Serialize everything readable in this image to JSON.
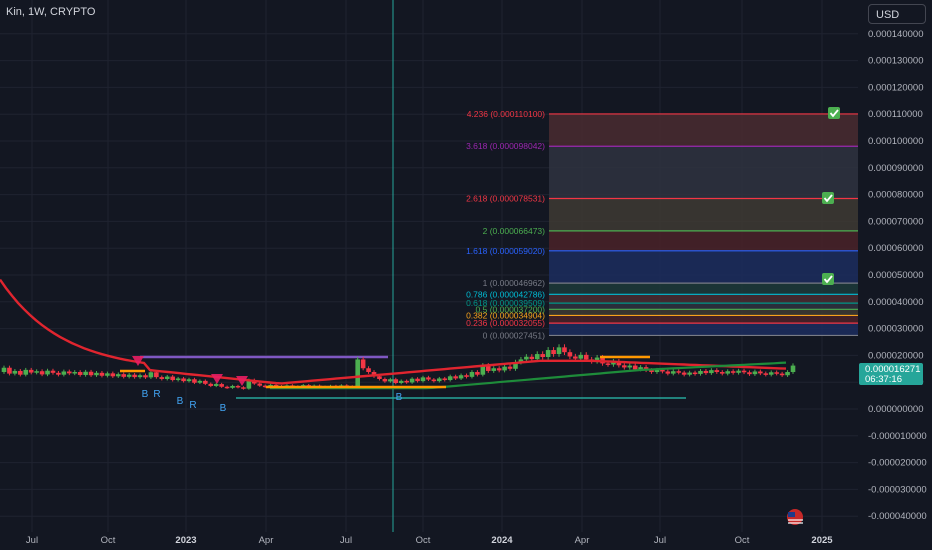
{
  "header": {
    "symbol": "Kin, 1W, CRYPTO",
    "currency": "USD"
  },
  "price_tag": {
    "price": "0.000016271",
    "timer": "06:37:16",
    "color": "#26a69a"
  },
  "colors": {
    "up": "#4caf50",
    "down": "#f23645",
    "background": "#131722",
    "grid": "#1f2330",
    "ma_red": "#e0252f",
    "ma_green": "#1e8c3a"
  },
  "chart_data": {
    "type": "candlestick",
    "y_axis": {
      "labels": [
        "0.000140000",
        "0.000130000",
        "0.000120000",
        "0.000110000",
        "0.000100000",
        "0.000090000",
        "0.000080000",
        "0.000070000",
        "0.000060000",
        "0.000050000",
        "0.000040000",
        "0.000030000",
        "0.000020000",
        "0.000010000",
        "0.000000000",
        "-0.000010000",
        "-0.000020000",
        "-0.000030000",
        "-0.000040000"
      ],
      "range": [
        -4.2e-05,
        0.000148
      ]
    },
    "x_axis": {
      "labels": [
        {
          "text": "Jul",
          "year": false
        },
        {
          "text": "Oct",
          "year": false
        },
        {
          "text": "2023",
          "year": true
        },
        {
          "text": "Apr",
          "year": false
        },
        {
          "text": "Jul",
          "year": false
        },
        {
          "text": "Oct",
          "year": false
        },
        {
          "text": "2024",
          "year": true
        },
        {
          "text": "Apr",
          "year": false
        },
        {
          "text": "Jul",
          "year": false
        },
        {
          "text": "Oct",
          "year": false
        },
        {
          "text": "2025",
          "year": true
        }
      ]
    },
    "fibonacci": [
      {
        "label": "4.236 (0.000110100)",
        "value": 0.0001101,
        "color": "#f23645"
      },
      {
        "label": "3.618 (0.000098042)",
        "value": 9.8042e-05,
        "color": "#9c27b0"
      },
      {
        "label": "2.618 (0.000078531)",
        "value": 7.8531e-05,
        "color": "#f23645"
      },
      {
        "label": "2 (0.000066473)",
        "value": 6.6473e-05,
        "color": "#4caf50"
      },
      {
        "label": "1.618 (0.000059020)",
        "value": 5.902e-05,
        "color": "#2962ff"
      },
      {
        "label": "1 (0.000046962)",
        "value": 4.6962e-05,
        "color": "#787b86"
      },
      {
        "label": "0.786 (0.000042786)",
        "value": 4.2786e-05,
        "color": "#00bcd4"
      },
      {
        "label": "0.618 (0.000039509)",
        "value": 3.9509e-05,
        "color": "#009688"
      },
      {
        "label": "0.5 (0.000037200)",
        "value": 3.72e-05,
        "color": "#4caf50"
      },
      {
        "label": "0.382 (0.000034904)",
        "value": 3.4904e-05,
        "color": "#f7a21b"
      },
      {
        "label": "0.236 (0.000032055)",
        "value": 3.2055e-05,
        "color": "#f23645"
      },
      {
        "label": "0 (0.000027451)",
        "value": 2.7451e-05,
        "color": "#787b86"
      }
    ],
    "fib_zones": [
      "#4a2c30",
      "#2f3340",
      "#3e3a33",
      "#4a2228",
      "#1c2d5e",
      "#1c3a3a"
    ],
    "markers": [
      "B",
      "R",
      "B",
      "R",
      "B",
      "B"
    ],
    "candles": [
      [
        1.38e-05,
        1.54e-05
      ],
      [
        1.54e-05,
        1.32e-05
      ],
      [
        1.32e-05,
        1.42e-05
      ],
      [
        1.42e-05,
        1.28e-05
      ],
      [
        1.28e-05,
        1.46e-05
      ],
      [
        1.46e-05,
        1.36e-05
      ],
      [
        1.36e-05,
        1.41e-05
      ],
      [
        1.41e-05,
        1.29e-05
      ],
      [
        1.29e-05,
        1.43e-05
      ],
      [
        1.43e-05,
        1.35e-05
      ],
      [
        1.35e-05,
        1.28e-05
      ],
      [
        1.28e-05,
        1.4e-05
      ],
      [
        1.4e-05,
        1.33e-05
      ],
      [
        1.33e-05,
        1.38e-05
      ],
      [
        1.38e-05,
        1.27e-05
      ],
      [
        1.27e-05,
        1.39e-05
      ],
      [
        1.39e-05,
        1.26e-05
      ],
      [
        1.26e-05,
        1.35e-05
      ],
      [
        1.35e-05,
        1.24e-05
      ],
      [
        1.24e-05,
        1.33e-05
      ],
      [
        1.33e-05,
        1.22e-05
      ],
      [
        1.22e-05,
        1.3e-05
      ],
      [
        1.3e-05,
        1.2e-05
      ],
      [
        1.2e-05,
        1.28e-05
      ],
      [
        1.28e-05,
        1.19e-05
      ],
      [
        1.19e-05,
        1.26e-05
      ],
      [
        1.26e-05,
        1.18e-05
      ],
      [
        1.18e-05,
        1.37e-05
      ],
      [
        1.37e-05,
        1.19e-05
      ],
      [
        1.19e-05,
        1.12e-05
      ],
      [
        1.12e-05,
        1.21e-05
      ],
      [
        1.21e-05,
        1.08e-05
      ],
      [
        1.08e-05,
        1.14e-05
      ],
      [
        1.14e-05,
        1.04e-05
      ],
      [
        1.04e-05,
        1.11e-05
      ],
      [
        1.11e-05,
        9.8e-06
      ],
      [
        9.8e-06,
        1.05e-05
      ],
      [
        1.05e-05,
        9.4e-06
      ],
      [
        9.4e-06,
        8.6e-06
      ],
      [
        8.6e-06,
        9.3e-06
      ],
      [
        9.3e-06,
        8.3e-06
      ],
      [
        8.3e-06,
        7.9e-06
      ],
      [
        7.9e-06,
        8.6e-06
      ],
      [
        8.6e-06,
        8.1e-06
      ],
      [
        8.1e-06,
        7.6e-06
      ],
      [
        7.6e-06,
        1.08e-05
      ],
      [
        1.08e-05,
        9.5e-06
      ],
      [
        9.5e-06,
        8.7e-06
      ],
      [
        8.7e-06,
        8.3e-06
      ],
      [
        8.3e-06,
        9e-06
      ],
      [
        9e-06,
        8.5e-06
      ],
      [
        8.5e-06,
        8.1e-06
      ],
      [
        8.1e-06,
        8.8e-06
      ],
      [
        8.8e-06,
        8.4e-06
      ],
      [
        8.4e-06,
        8e-06
      ],
      [
        8e-06,
        8.9e-06
      ],
      [
        8.9e-06,
        8.2e-06
      ],
      [
        8.2e-06,
        8.7e-06
      ],
      [
        8.7e-06,
        8.3e-06
      ],
      [
        8.3e-06,
        7.9e-06
      ],
      [
        7.9e-06,
        8.6e-06
      ],
      [
        8.6e-06,
        8.2e-06
      ],
      [
        8.2e-06,
        8.8e-06
      ],
      [
        8.8e-06,
        8.4e-06
      ],
      [
        8.4e-06,
        8e-06
      ],
      [
        8e-06,
        1.85e-05
      ],
      [
        1.85e-05,
        1.52e-05
      ],
      [
        1.52e-05,
        1.38e-05
      ],
      [
        1.38e-05,
        1.22e-05
      ],
      [
        1.22e-05,
        1.12e-05
      ],
      [
        1.12e-05,
        1.03e-05
      ],
      [
        1.03e-05,
        1.11e-05
      ],
      [
        1.11e-05,
        9.7e-06
      ],
      [
        9.7e-06,
        1.05e-05
      ],
      [
        1.05e-05,
        9.9e-06
      ],
      [
        9.9e-06,
        1.13e-05
      ],
      [
        1.13e-05,
        1.04e-05
      ],
      [
        1.04e-05,
        1.18e-05
      ],
      [
        1.18e-05,
        1.1e-05
      ],
      [
        1.1e-05,
        1.04e-05
      ],
      [
        1.04e-05,
        1.14e-05
      ],
      [
        1.14e-05,
        1.08e-05
      ],
      [
        1.08e-05,
        1.22e-05
      ],
      [
        1.22e-05,
        1.14e-05
      ],
      [
        1.14e-05,
        1.26e-05
      ],
      [
        1.26e-05,
        1.2e-05
      ],
      [
        1.2e-05,
        1.38e-05
      ],
      [
        1.38e-05,
        1.28e-05
      ],
      [
        1.28e-05,
        1.63e-05
      ],
      [
        1.63e-05,
        1.42e-05
      ],
      [
        1.42e-05,
        1.52e-05
      ],
      [
        1.52e-05,
        1.44e-05
      ],
      [
        1.44e-05,
        1.58e-05
      ],
      [
        1.58e-05,
        1.5e-05
      ],
      [
        1.5e-05,
        1.75e-05
      ],
      [
        1.75e-05,
        1.85e-05
      ],
      [
        1.85e-05,
        1.95e-05
      ],
      [
        1.95e-05,
        1.86e-05
      ],
      [
        1.86e-05,
        2.05e-05
      ],
      [
        2.05e-05,
        1.94e-05
      ],
      [
        1.94e-05,
        2.2e-05
      ],
      [
        2.2e-05,
        2.05e-05
      ],
      [
        2.05e-05,
        2.3e-05
      ],
      [
        2.3e-05,
        2.12e-05
      ],
      [
        2.12e-05,
        1.96e-05
      ],
      [
        1.96e-05,
        1.88e-05
      ],
      [
        1.88e-05,
        2.02e-05
      ],
      [
        2.02e-05,
        1.85e-05
      ],
      [
        1.85e-05,
        1.78e-05
      ],
      [
        1.78e-05,
        1.92e-05
      ],
      [
        1.92e-05,
        1.7e-05
      ],
      [
        1.7e-05,
        1.66e-05
      ],
      [
        1.66e-05,
        1.78e-05
      ],
      [
        1.78e-05,
        1.63e-05
      ],
      [
        1.63e-05,
        1.55e-05
      ],
      [
        1.55e-05,
        1.62e-05
      ],
      [
        1.62e-05,
        1.48e-05
      ],
      [
        1.48e-05,
        1.56e-05
      ],
      [
        1.56e-05,
        1.45e-05
      ],
      [
        1.45e-05,
        1.38e-05
      ],
      [
        1.38e-05,
        1.46e-05
      ],
      [
        1.46e-05,
        1.4e-05
      ],
      [
        1.4e-05,
        1.32e-05
      ],
      [
        1.32e-05,
        1.41e-05
      ],
      [
        1.41e-05,
        1.36e-05
      ],
      [
        1.36e-05,
        1.28e-05
      ],
      [
        1.28e-05,
        1.36e-05
      ],
      [
        1.36e-05,
        1.31e-05
      ],
      [
        1.31e-05,
        1.42e-05
      ],
      [
        1.42e-05,
        1.34e-05
      ],
      [
        1.34e-05,
        1.45e-05
      ],
      [
        1.45e-05,
        1.38e-05
      ],
      [
        1.38e-05,
        1.32e-05
      ],
      [
        1.32e-05,
        1.41e-05
      ],
      [
        1.41e-05,
        1.35e-05
      ],
      [
        1.35e-05,
        1.43e-05
      ],
      [
        1.43e-05,
        1.37e-05
      ],
      [
        1.37e-05,
        1.3e-05
      ],
      [
        1.3e-05,
        1.4e-05
      ],
      [
        1.4e-05,
        1.33e-05
      ],
      [
        1.33e-05,
        1.28e-05
      ],
      [
        1.28e-05,
        1.37e-05
      ],
      [
        1.37e-05,
        1.32e-05
      ],
      [
        1.32e-05,
        1.26e-05
      ],
      [
        1.26e-05,
        1.38e-05
      ],
      [
        1.38e-05,
        1.62e-05
      ]
    ]
  }
}
